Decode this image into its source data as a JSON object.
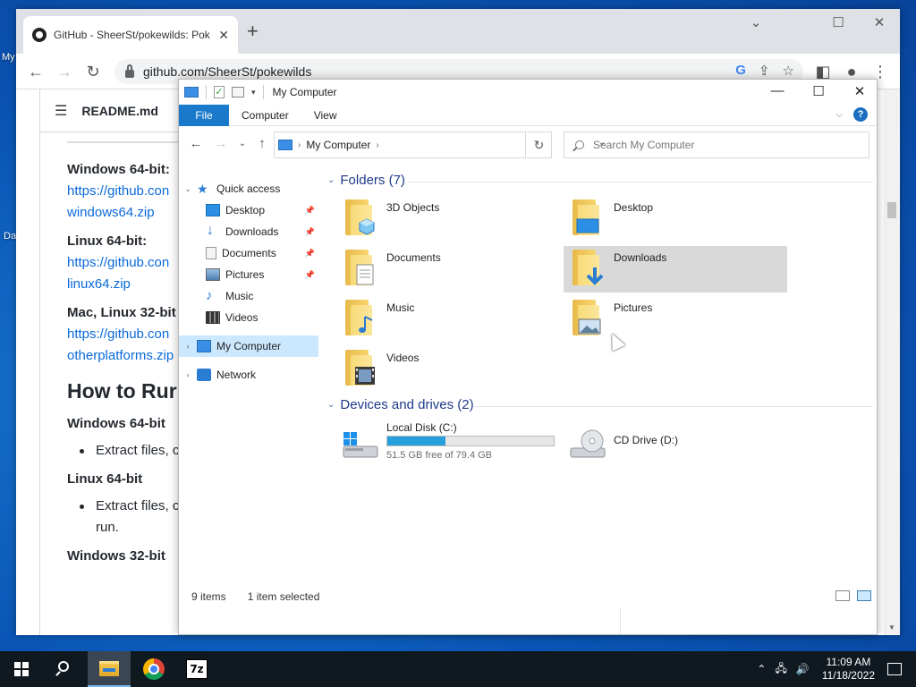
{
  "desktop": {
    "frag1": "My",
    "frag2": "Da"
  },
  "browser": {
    "tab_title": "GitHub - SheerSt/pokewilds: Pok",
    "tab_close": "✕",
    "new_tab": "+",
    "url": "github.com/SheerSt/pokewilds",
    "controls": {
      "minimize": "⌄",
      "restore": "☐",
      "close": "✕"
    }
  },
  "readme": {
    "title": "README.md",
    "lines": [
      {
        "kind": "h3",
        "text": "Windows 64-bit:"
      },
      {
        "kind": "link",
        "text": "https://github.con"
      },
      {
        "kind": "link",
        "text": "windows64.zip"
      },
      {
        "kind": "h3",
        "text": "Linux 64-bit:"
      },
      {
        "kind": "link",
        "text": "https://github.con"
      },
      {
        "kind": "link",
        "text": "linux64.zip"
      },
      {
        "kind": "h3",
        "text": "Mac, Linux 32-bit"
      },
      {
        "kind": "link",
        "text": "https://github.con"
      },
      {
        "kind": "link",
        "text": "otherplatforms.zip"
      },
      {
        "kind": "h2",
        "text": "How to Rur"
      },
      {
        "kind": "h3",
        "text": "Windows 64-bit"
      },
      {
        "kind": "bullet",
        "text": "Extract files, c"
      },
      {
        "kind": "h3",
        "text": "Linux 64-bit"
      },
      {
        "kind": "bullet",
        "text": "Extract files, c"
      },
      {
        "kind": "cont",
        "text": "run."
      },
      {
        "kind": "h3",
        "text": "Windows 32-bit"
      }
    ]
  },
  "explorer": {
    "title": "My Computer",
    "ribbon": {
      "file": "File",
      "tabs": [
        "Computer",
        "View"
      ],
      "help": "?"
    },
    "address": "My Computer",
    "search_placeholder": "Search My Computer",
    "nav": {
      "quick_access": "Quick access",
      "quick_items": [
        "Desktop",
        "Downloads",
        "Documents",
        "Pictures",
        "Music",
        "Videos"
      ],
      "pin": "📌",
      "my_computer": "My Computer",
      "network": "Network"
    },
    "folders_header": "Folders (7)",
    "folders": [
      "3D Objects",
      "Desktop",
      "Documents",
      "Downloads",
      "Music",
      "Pictures",
      "Videos"
    ],
    "selected_folder": "Downloads",
    "drives_header": "Devices and drives (2)",
    "drives": [
      {
        "name": "Local Disk (C:)",
        "free": "51.5 GB free of 79.4 GB",
        "used_fraction": 0.351
      },
      {
        "name": "CD Drive (D:)"
      }
    ],
    "status": {
      "items": "9 items",
      "selected": "1 item selected"
    }
  },
  "taskbar": {
    "time": "11:09 AM",
    "date": "11/18/2022",
    "zip_label": "7z"
  },
  "colors": {
    "accent": "#1979ca",
    "selection": "#cce8ff",
    "drive_fill": "#26a0da",
    "link": "#0969da"
  }
}
